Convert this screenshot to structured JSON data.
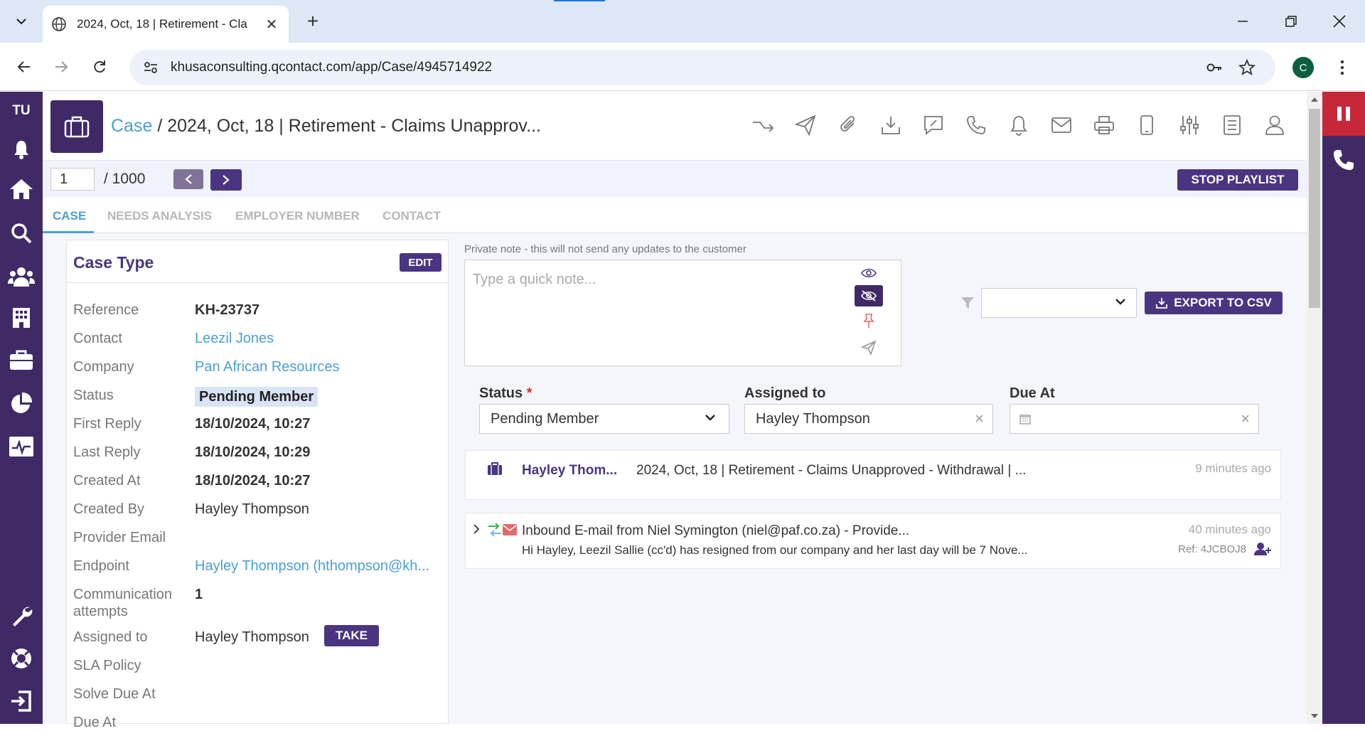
{
  "browser": {
    "tab_title": "2024, Oct, 18 | Retirement - Cla",
    "url": "khusaconsulting.qcontact.com/app/Case/4945714922",
    "profile_initial": "C"
  },
  "sidebar": {
    "brand": "TU",
    "icons": [
      "bell-icon",
      "home-icon",
      "search-icon",
      "people-icon",
      "building-icon",
      "briefcase-icon",
      "pie-chart-icon",
      "activity-monitor-icon",
      "wrench-icon",
      "lifebuoy-icon",
      "logout-icon"
    ]
  },
  "header": {
    "crumb_root": "Case",
    "crumb_sep": "/",
    "crumb_current": "2024, Oct, 18 | Retirement - Claims Unapprov..."
  },
  "playlist": {
    "current": "1",
    "total": "/ 1000",
    "stop_label": "STOP PLAYLIST"
  },
  "tabs": [
    {
      "label": "CASE"
    },
    {
      "label": "NEEDS ANALYSIS"
    },
    {
      "label": "EMPLOYER NUMBER"
    },
    {
      "label": "CONTACT"
    }
  ],
  "case_card": {
    "title": "Case Type",
    "edit_label": "EDIT",
    "fields": [
      {
        "label": "Reference",
        "value": "KH-23737"
      },
      {
        "label": "Contact",
        "value": "Leezil Jones"
      },
      {
        "label": "Company",
        "value": "Pan African Resources"
      },
      {
        "label": "Status",
        "value": "Pending Member"
      },
      {
        "label": "First Reply",
        "value": "18/10/2024, 10:27"
      },
      {
        "label": "Last Reply",
        "value": "18/10/2024, 10:29"
      },
      {
        "label": "Created At",
        "value": "18/10/2024, 10:27"
      },
      {
        "label": "Created By",
        "value": "Hayley Thompson"
      },
      {
        "label": "Provider Email",
        "value": ""
      },
      {
        "label": "Endpoint",
        "value": "Hayley Thompson (hthompson@kh..."
      },
      {
        "label": "Communication attempts",
        "value": "1"
      },
      {
        "label": "Assigned to",
        "value": "Hayley Thompson"
      },
      {
        "label": "SLA Policy",
        "value": ""
      },
      {
        "label": "Solve Due At",
        "value": ""
      },
      {
        "label": "Due At",
        "value": ""
      }
    ],
    "take_label": "TAKE"
  },
  "note": {
    "label": "Private note - this will not send any updates to the customer",
    "placeholder": "Type a quick note..."
  },
  "filter": {
    "export_label": "EXPORT TO CSV"
  },
  "form": {
    "status_label": "Status",
    "required_mark": "*",
    "status_value": "Pending Member",
    "assigned_label": "Assigned to",
    "assigned_value": "Hayley Thompson",
    "due_label": "Due At",
    "clear_glyph": "×"
  },
  "activities": [
    {
      "author": "Hayley Thom...",
      "text": "2024, Oct, 18 | Retirement - Claims Unapproved - Withdrawal | ...",
      "time": "9 minutes ago"
    },
    {
      "title": "Inbound E-mail from Niel Symington (niel@paf.co.za) - Provide...",
      "snippet": "Hi Hayley,   Leezil Sallie (cc'd) has resigned from our company and her last day will be 7 Nove...",
      "time": "40 minutes ago",
      "ref": "Ref: 4JCBOJ8"
    }
  ],
  "colors": {
    "brand_purple": "#3f2a66",
    "button_purple": "#4a3580",
    "link_blue": "#4a9fd4",
    "pause_red": "#c62839"
  }
}
